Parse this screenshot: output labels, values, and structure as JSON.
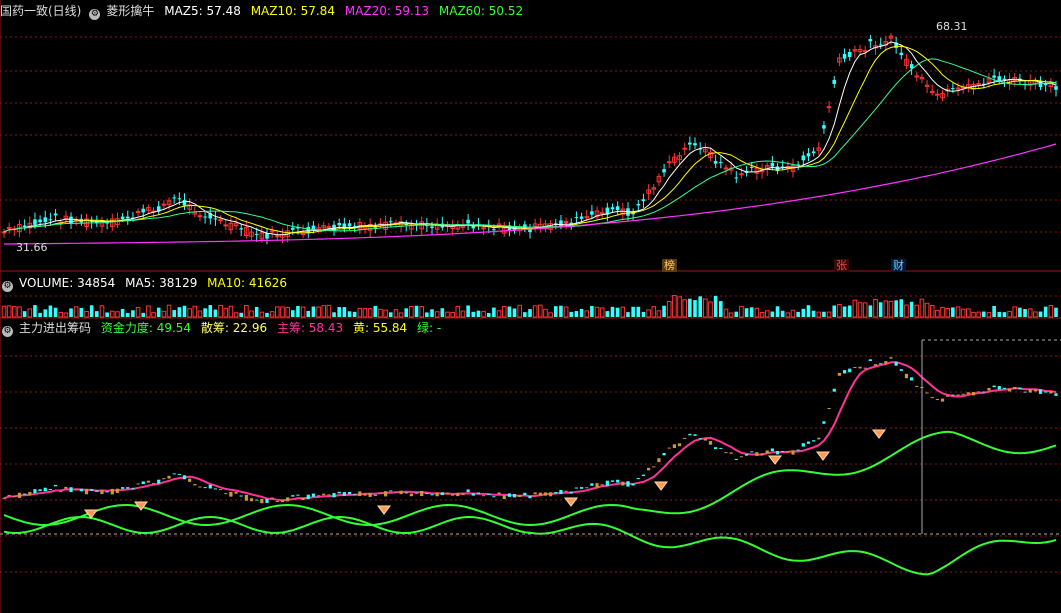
{
  "main": {
    "stock_name": "国药一致(日线)",
    "indicator_name": "菱形擒牛",
    "ma": [
      {
        "label": "MAZ5: 57.48",
        "color": "#ffffff"
      },
      {
        "label": "MAZ10: 57.84",
        "color": "#ffff00"
      },
      {
        "label": "MAZ20: 59.13",
        "color": "#ff33ff"
      },
      {
        "label": "MAZ60: 50.52",
        "color": "#33ff33"
      }
    ],
    "high_label": "68.31",
    "low_label": "31.66",
    "events": [
      {
        "text": "榜",
        "color": "#ffcc66",
        "bg": "#5a3a10",
        "x": 669
      },
      {
        "text": "张",
        "color": "#ff4444",
        "bg": "#3a0808",
        "x": 841
      },
      {
        "text": "财",
        "color": "#66ccff",
        "bg": "#081a3a",
        "x": 898
      }
    ]
  },
  "volume": {
    "items": [
      {
        "label": "VOLUME: 34854",
        "color": "#ffffff"
      },
      {
        "label": "MA5: 38129",
        "color": "#ffffff"
      },
      {
        "label": "MA10: 41626",
        "color": "#ffff00"
      }
    ]
  },
  "flow": {
    "title": "主力进出筹码",
    "items": [
      {
        "label": "资金力度: 49.54",
        "color": "#33ff33"
      },
      {
        "label": "散筹: 22.96",
        "color": "#ffff66"
      },
      {
        "label": "主筹: 58.43",
        "color": "#ff3399"
      },
      {
        "label": "黄: 55.84",
        "color": "#ffff00"
      },
      {
        "label": "绿: -",
        "color": "#33ff33"
      }
    ]
  },
  "chart_data": {
    "type": "line",
    "series": [],
    "colors": {
      "up": "#ff3333",
      "down": "#33ffff",
      "ma5": "#ffffff",
      "ma10": "#ffff00",
      "ma20": "#33ff99",
      "ma60": "#ff33ff",
      "flow_green": "#33ff33",
      "flow_pink": "#ff3399",
      "grid": "#8a1a1a"
    }
  }
}
